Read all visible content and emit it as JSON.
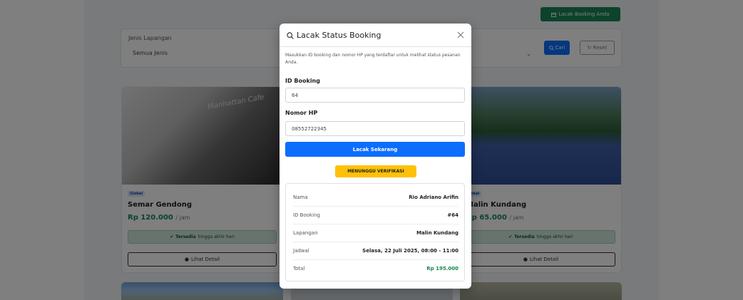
{
  "header": {
    "track_button_label": "Lacak Booking Anda",
    "track_button_color": "#198754"
  },
  "filter": {
    "type_label": "Jenis Lapangan",
    "type_value": "Semua Jenis",
    "search_button": "Cari",
    "reset_button": "Reset"
  },
  "cards": [
    {
      "badge": "Global",
      "name": "Semar Gendong",
      "price": "Rp 120.000",
      "unit": "/ jam",
      "image_text": "Manhattan Cafe",
      "availability_bold": "Tersedia",
      "availability_rest": "hingga akhir hari",
      "detail_button": "Lihat Detail"
    },
    {
      "badge": "Lokal",
      "name": "Malin Kundang",
      "price": "Rp 65.000",
      "unit": "/ jam",
      "availability_bold": "Tersedia",
      "availability_rest": "hingga akhir hari",
      "detail_button": "Lihat Detail"
    }
  ],
  "modal": {
    "title": "Lacak Status Booking",
    "description": "Masukkan ID booking dan nomor HP yang terdaftar untuk melihat status pesanan Anda.",
    "booking_id_label": "ID Booking",
    "booking_id_value": "64",
    "phone_label": "Nomor HP",
    "phone_value": "08552722345",
    "submit_label": "Lacak Sekarang",
    "status_badge": "MENUNGGU VERIFIKASI",
    "result": [
      {
        "key": "Nama",
        "value": "Rio Adriano Arifin"
      },
      {
        "key": "ID Booking",
        "value": "#64"
      },
      {
        "key": "Lapangan",
        "value": "Malin Kundang"
      },
      {
        "key": "Jadwal",
        "value": "Selasa, 22 Juli 2025, 08:00 - 11:00"
      },
      {
        "key": "Total",
        "value": "Rp 195.000"
      }
    ]
  },
  "colors": {
    "primary": "#0d6efd",
    "success": "#198754",
    "warning": "#ffc107"
  }
}
